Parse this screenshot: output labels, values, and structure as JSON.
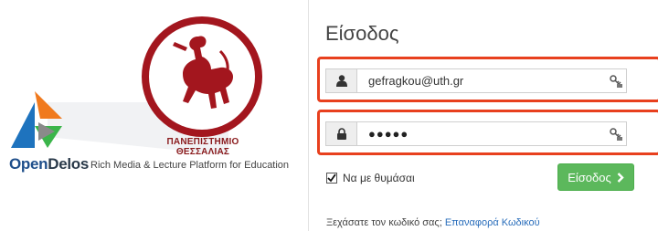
{
  "branding": {
    "university_name": "ΠΑΝΕΠΙΣΤΗΜΙΟ ΘΕΣΣΑΛΙΑΣ",
    "product_name_part1": "Open",
    "product_name_part2": "Delos",
    "tagline": "Rich Media & Lecture Platform for Education",
    "seal_icon": "centaur-seal-icon",
    "logo_icon": "opendelos-triangle-logo-icon",
    "colors": {
      "seal_red": "#a3161e",
      "logo_blue": "#1e73be",
      "logo_green": "#3bb54a",
      "logo_orange": "#f07a1e"
    }
  },
  "login": {
    "title": "Είσοδος",
    "username": {
      "value": "gefragkou@uth.gr",
      "icon": "user-icon",
      "key_icon": "password-manager-key-icon"
    },
    "password": {
      "value": "●●●●●",
      "icon": "lock-icon",
      "key_icon": "password-manager-key-icon"
    },
    "remember_label": "Να με θυμάσαι",
    "remember_checked": true,
    "submit_label": "Είσοδος",
    "forgot_prompt": "Ξεχάσατε τον κωδικό σας;",
    "forgot_link": "Επαναφορά Κωδικού",
    "colors": {
      "highlight": "#e8401e",
      "button": "#5cb85c",
      "link": "#2a6ebb"
    }
  }
}
